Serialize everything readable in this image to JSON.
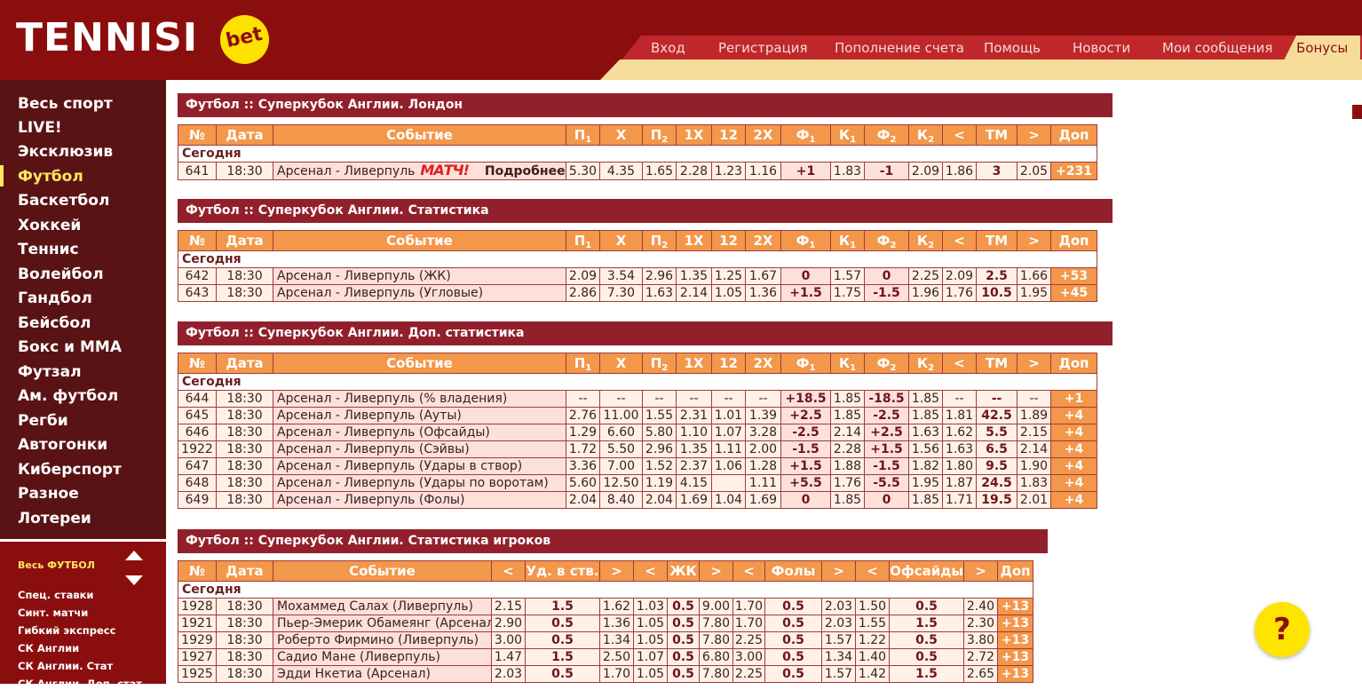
{
  "header": {
    "logo_text": "TENNISI",
    "logo_badge": "bet",
    "nav": [
      "Вход",
      "Регистрация",
      "Пополнение счета",
      "Помощь",
      "Новости",
      "Мои сообщения",
      "Бонусы"
    ]
  },
  "sidebar": {
    "items": [
      "Весь спорт",
      "LIVE!",
      "Эксклюзив",
      "Футбол",
      "Баскетбол",
      "Хоккей",
      "Теннис",
      "Волейбол",
      "Гандбол",
      "Бейсбол",
      "Бокс и MMA",
      "Футзал",
      "Ам. футбол",
      "Регби",
      "Автогонки",
      "Киберспорт",
      "Разное",
      "Лотереи"
    ],
    "active": "Футбол",
    "sub_title": "Весь ФУТБОЛ",
    "sub_items": [
      "Спец. ставки",
      "Синт. матчи",
      "Гибкий экспресс",
      "СК Англии",
      "СК Англии. Стат",
      "СК Англии. Доп. стат"
    ]
  },
  "odds_headers": {
    "num": "№",
    "date": "Дата",
    "event": "Событие",
    "p1": "П",
    "x": "Х",
    "p2": "П",
    "x1": "1Х",
    "x12": "12",
    "x2": "2Х",
    "f1": "Ф",
    "k1": "К",
    "f2": "Ф",
    "k2": "К",
    "lt": "<",
    "tm": "ТМ",
    "gt": ">",
    "dop": "Доп",
    "sub1": "1",
    "sub2": "2"
  },
  "today_label": "Сегодня",
  "block1": {
    "title": "Футбол :: Суперкубок Англии. Лондон",
    "match_logo": "МАТЧ!",
    "more": "Подробнее",
    "rows": [
      [
        "641",
        "18:30",
        "Арсенал - Ливерпуль",
        "5.30",
        "4.35",
        "1.65",
        "2.28",
        "1.23",
        "1.16",
        "+1",
        "1.83",
        "-1",
        "2.09",
        "1.86",
        "3",
        "2.05",
        "+231"
      ]
    ]
  },
  "block2": {
    "title": "Футбол :: Суперкубок Англии. Статистика",
    "rows": [
      [
        "642",
        "18:30",
        "Арсенал - Ливерпуль (ЖК)",
        "2.09",
        "3.54",
        "2.96",
        "1.35",
        "1.25",
        "1.67",
        "0",
        "1.57",
        "0",
        "2.25",
        "2.09",
        "2.5",
        "1.66",
        "+53"
      ],
      [
        "643",
        "18:30",
        "Арсенал - Ливерпуль (Угловые)",
        "2.86",
        "7.30",
        "1.63",
        "2.14",
        "1.05",
        "1.36",
        "+1.5",
        "1.75",
        "-1.5",
        "1.96",
        "1.76",
        "10.5",
        "1.95",
        "+45"
      ]
    ]
  },
  "block3": {
    "title": "Футбол :: Суперкубок Англии. Доп. статистика",
    "rows": [
      [
        "644",
        "18:30",
        "Арсенал - Ливерпуль (% владения)",
        "--",
        "--",
        "--",
        "--",
        "--",
        "--",
        "+18.5",
        "1.85",
        "-18.5",
        "1.85",
        "--",
        "--",
        "--",
        "+1"
      ],
      [
        "645",
        "18:30",
        "Арсенал - Ливерпуль (Ауты)",
        "2.76",
        "11.00",
        "1.55",
        "2.31",
        "1.01",
        "1.39",
        "+2.5",
        "1.85",
        "-2.5",
        "1.85",
        "1.81",
        "42.5",
        "1.89",
        "+4"
      ],
      [
        "646",
        "18:30",
        "Арсенал - Ливерпуль (Офсайды)",
        "1.29",
        "6.60",
        "5.80",
        "1.10",
        "1.07",
        "3.28",
        "-2.5",
        "2.14",
        "+2.5",
        "1.63",
        "1.62",
        "5.5",
        "2.15",
        "+4"
      ],
      [
        "1922",
        "18:30",
        "Арсенал - Ливерпуль (Сэйвы)",
        "1.72",
        "5.50",
        "2.96",
        "1.35",
        "1.11",
        "2.00",
        "-1.5",
        "2.28",
        "+1.5",
        "1.56",
        "1.63",
        "6.5",
        "2.14",
        "+4"
      ],
      [
        "647",
        "18:30",
        "Арсенал - Ливерпуль (Удары в створ)",
        "3.36",
        "7.00",
        "1.52",
        "2.37",
        "1.06",
        "1.28",
        "+1.5",
        "1.88",
        "-1.5",
        "1.82",
        "1.80",
        "9.5",
        "1.90",
        "+4"
      ],
      [
        "648",
        "18:30",
        "Арсенал - Ливерпуль (Удары по воротам)",
        "5.60",
        "12.50",
        "1.19",
        "4.15",
        "",
        "1.11",
        "+5.5",
        "1.76",
        "-5.5",
        "1.95",
        "1.87",
        "24.5",
        "1.83",
        "+4"
      ],
      [
        "649",
        "18:30",
        "Арсенал - Ливерпуль (Фолы)",
        "2.04",
        "8.40",
        "2.04",
        "1.69",
        "1.04",
        "1.69",
        "0",
        "1.85",
        "0",
        "1.85",
        "1.71",
        "19.5",
        "2.01",
        "+4"
      ]
    ]
  },
  "block4": {
    "title": "Футбол :: Суперкубок Англии. Статистика игроков",
    "headers": [
      "№",
      "Дата",
      "Событие",
      "<",
      "Уд. в ств.",
      ">",
      "<",
      "ЖК",
      ">",
      "<",
      "Фолы",
      ">",
      "<",
      "Офсайды",
      ">",
      "Доп"
    ],
    "rows": [
      [
        "1928",
        "18:30",
        "Мохаммед Салах (Ливерпуль)",
        "2.15",
        "1.5",
        "1.62",
        "1.03",
        "0.5",
        "9.00",
        "1.70",
        "0.5",
        "2.03",
        "1.50",
        "0.5",
        "2.40",
        "+13"
      ],
      [
        "1921",
        "18:30",
        "Пьер-Эмерик Обамеянг (Арсенал)",
        "2.90",
        "0.5",
        "1.36",
        "1.05",
        "0.5",
        "7.80",
        "1.70",
        "0.5",
        "2.03",
        "1.55",
        "1.5",
        "2.30",
        "+13"
      ],
      [
        "1929",
        "18:30",
        "Роберто Фирмино (Ливерпуль)",
        "3.00",
        "0.5",
        "1.34",
        "1.05",
        "0.5",
        "7.80",
        "2.25",
        "0.5",
        "1.57",
        "1.22",
        "0.5",
        "3.80",
        "+13"
      ],
      [
        "1927",
        "18:30",
        "Садио Мане (Ливерпуль)",
        "1.47",
        "1.5",
        "2.50",
        "1.07",
        "0.5",
        "6.80",
        "3.00",
        "0.5",
        "1.34",
        "1.40",
        "0.5",
        "2.72",
        "+13"
      ],
      [
        "1925",
        "18:30",
        "Эдди Нкетиа (Арсенал)",
        "2.03",
        "0.5",
        "1.70",
        "1.05",
        "0.5",
        "7.80",
        "2.25",
        "0.5",
        "1.57",
        "1.42",
        "1.5",
        "2.65",
        "+13"
      ]
    ]
  },
  "help_label": "?",
  "colors": {
    "brand": "#8b0e0f",
    "accent": "#ffe100",
    "header_cell": "#f3974a",
    "title_bar": "#92202c"
  }
}
